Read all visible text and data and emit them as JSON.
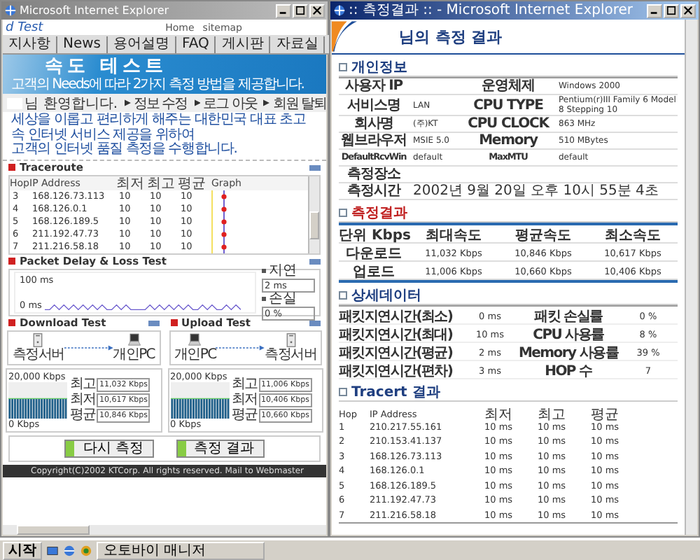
{
  "left_window": {
    "title": "Microsoft Internet Explorer",
    "site_title": "d Test",
    "top_links": [
      "Home",
      "sitemap"
    ],
    "nav": [
      "지사항",
      "News",
      "용어설명",
      "FAQ",
      "게시판",
      "자료실"
    ],
    "banner": {
      "title": "속도 테스트",
      "subtitle": "고객의 Needs에 따라 2가지 측정 방법을 제공합니다."
    },
    "welcome": "님 환영합니다.",
    "account_links": [
      "정보 수정",
      "로그 아웃",
      "회원 탈퇴"
    ],
    "intro": [
      "세상을 이롭고 편리하게 해주는 대한민국 대표 초고속 인터넷 서비스 제공을 위하여",
      "고객의 인터넷 품질 측정을 수행합니다."
    ],
    "traceroute": {
      "title": "Traceroute",
      "columns": [
        "Hop",
        "IP Address",
        "최저",
        "최고",
        "평균",
        "Graph"
      ],
      "rows": [
        {
          "hop": "3",
          "ip": "168.126.73.113",
          "min": "10",
          "max": "10",
          "avg": "10"
        },
        {
          "hop": "4",
          "ip": "168.126.0.1",
          "min": "10",
          "max": "10",
          "avg": "10"
        },
        {
          "hop": "5",
          "ip": "168.126.189.5",
          "min": "10",
          "max": "10",
          "avg": "10"
        },
        {
          "hop": "6",
          "ip": "211.192.47.73",
          "min": "10",
          "max": "10",
          "avg": "10"
        },
        {
          "hop": "7",
          "ip": "211.216.58.18",
          "min": "10",
          "max": "10",
          "avg": "10"
        }
      ]
    },
    "delay_test": {
      "title": "Packet Delay & Loss Test",
      "scale_top": "100 ms",
      "scale_bottom": "0 ms",
      "readouts": [
        {
          "label": "지연",
          "value": "2 ms"
        },
        {
          "label": "손실",
          "value": "0 %"
        }
      ]
    },
    "tests": [
      {
        "title": "Download Test",
        "from": "측정서버",
        "to": "개인PC",
        "scale_top": "20,000 Kbps",
        "scale_bottom": "0 Kbps",
        "stats": [
          {
            "label": "최고",
            "value": "11,032 Kbps"
          },
          {
            "label": "최저",
            "value": "10,617 Kbps"
          },
          {
            "label": "평균",
            "value": "10,846 Kbps"
          }
        ]
      },
      {
        "title": "Upload Test",
        "from": "개인PC",
        "to": "측정서버",
        "scale_top": "20,000 Kbps",
        "scale_bottom": "0 Kbps",
        "stats": [
          {
            "label": "최고",
            "value": "11,006 Kbps"
          },
          {
            "label": "최저",
            "value": "10,406 Kbps"
          },
          {
            "label": "평균",
            "value": "10,660 Kbps"
          }
        ]
      }
    ],
    "buttons": [
      "다시 측정",
      "측정 결과"
    ],
    "footer": "Copyright(C)2002 KTCorp. All rights reserved. Mail to Webmaster"
  },
  "right_window": {
    "title": ":: 측정결과 :: - Microsoft Internet Explorer",
    "heading": "님의 측정 결과",
    "personal": {
      "title": "개인정보",
      "rows": [
        {
          "label": "사용자 IP",
          "label2": "운영체제",
          "value2": "Windows 2000"
        },
        {
          "label": "서비스명",
          "value": "LAN",
          "label2": "CPU TYPE",
          "value2": "Pentium(r)III Family 6 Model 8 Stepping 10"
        },
        {
          "label": "회사명",
          "value": "(주)KT",
          "label2": "CPU CLOCK",
          "value2": "863 MHz"
        },
        {
          "label": "웹브라우저",
          "value": "MSIE 5.0",
          "label2": "Memory",
          "value2": "510 MBytes"
        },
        {
          "label": "DefaultRcvWin",
          "value": "default",
          "label2": "MaxMTU",
          "value2": "default"
        },
        {
          "label": "측정장소"
        },
        {
          "label": "측정시간",
          "value": "2002년 9월 20일 오후 10시 55분 4초"
        }
      ]
    },
    "results": {
      "title": "측정결과",
      "columns": [
        "단위 Kbps",
        "최대속도",
        "평균속도",
        "최소속도"
      ],
      "rows": [
        [
          "다운로드",
          "11,032 Kbps",
          "10,846 Kbps",
          "10,617 Kbps"
        ],
        [
          "업로드",
          "11,006 Kbps",
          "10,660 Kbps",
          "10,406 Kbps"
        ]
      ]
    },
    "details": {
      "title": "상세데이터",
      "rows": [
        {
          "label": "패킷지연시간(최소)",
          "value": "0 ms",
          "label2": "패킷 손실률",
          "value2": "0 %"
        },
        {
          "label": "패킷지연시간(최대)",
          "value": "10 ms",
          "label2": "CPU 사용률",
          "value2": "8 %"
        },
        {
          "label": "패킷지연시간(평균)",
          "value": "2 ms",
          "label2": "Memory 사용률",
          "value2": "39 %"
        },
        {
          "label": "패킷지연시간(편차)",
          "value": "3 ms",
          "label2": "HOP 수",
          "value2": "7"
        }
      ]
    },
    "tracert": {
      "title": "Tracert 결과",
      "columns": [
        "Hop",
        "IP Address",
        "최저",
        "최고",
        "평균"
      ],
      "rows": [
        [
          "1",
          "210.217.55.161",
          "10 ms",
          "10 ms",
          "10 ms"
        ],
        [
          "2",
          "210.153.41.137",
          "10 ms",
          "10 ms",
          "10 ms"
        ],
        [
          "3",
          "168.126.73.113",
          "10 ms",
          "10 ms",
          "10 ms"
        ],
        [
          "4",
          "168.126.0.1",
          "10 ms",
          "10 ms",
          "10 ms"
        ],
        [
          "5",
          "168.126.189.5",
          "10 ms",
          "10 ms",
          "10 ms"
        ],
        [
          "6",
          "211.192.47.73",
          "10 ms",
          "10 ms",
          "10 ms"
        ],
        [
          "7",
          "211.216.58.18",
          "10 ms",
          "10 ms",
          "10 ms"
        ]
      ]
    }
  },
  "taskbar": {
    "start": "시작",
    "tasks": [
      "오토바이 매니저"
    ]
  }
}
